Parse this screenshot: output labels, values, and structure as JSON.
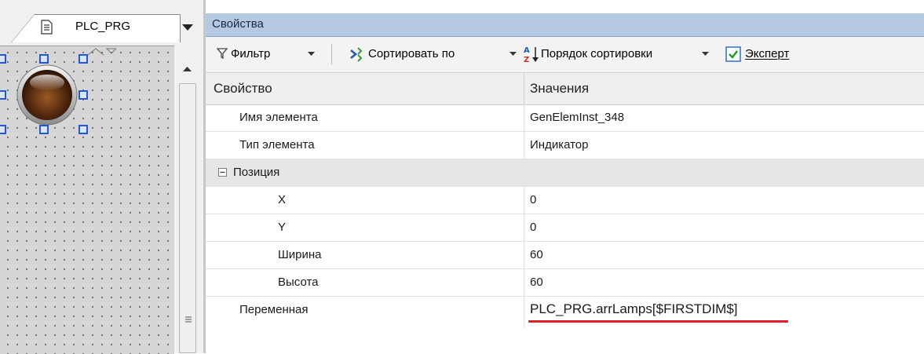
{
  "editor": {
    "tab_label": "PLC_PRG"
  },
  "properties": {
    "title": "Свойства",
    "toolbar": {
      "filter_label": "Фильтр",
      "sort_by_label": "Сортировать по",
      "sort_order_label": "Порядок сортировки",
      "expert_label": "Эксперт",
      "expert_checked": true
    },
    "header": {
      "property": "Свойство",
      "value": "Значения"
    },
    "rows": [
      {
        "name": "Имя элемента",
        "value": "GenElemInst_348"
      },
      {
        "name": "Тип элемента",
        "value": "Индикатор"
      },
      {
        "name": "Позиция",
        "value": "",
        "group": true,
        "expanded": true
      },
      {
        "name": "X",
        "value": "0"
      },
      {
        "name": "Y",
        "value": "0"
      },
      {
        "name": "Ширина",
        "value": "60"
      },
      {
        "name": "Высота",
        "value": "60"
      },
      {
        "name": "Переменная",
        "value": "PLC_PRG.arrLamps[$FIRSTDIM$]"
      }
    ]
  },
  "colors": {
    "title_bar": "#b6c9e3",
    "highlight_underline": "#e0202a",
    "selection_handle": "#2457d1",
    "lamp": "#5a2d10"
  },
  "icons": [
    "document-icon",
    "funnel-icon",
    "sort-icon",
    "az-sort-icon",
    "checkbox-icon",
    "collapse-icon",
    "dropdown-arrow-icon",
    "scroll-up-icon"
  ]
}
